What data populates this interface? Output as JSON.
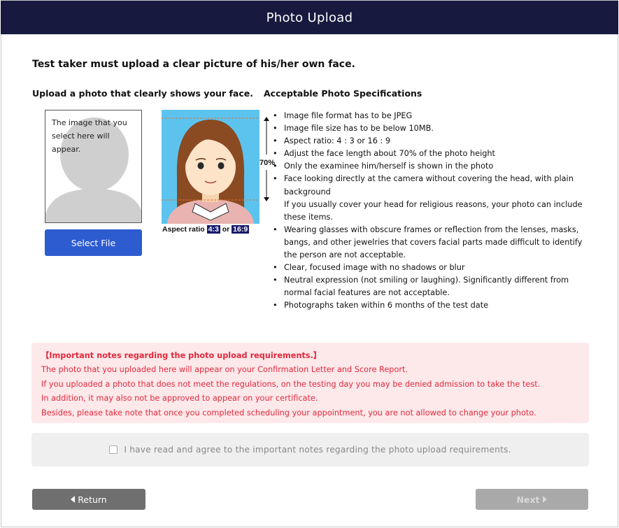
{
  "header": {
    "title": "Photo Upload"
  },
  "intro": "Test taker must upload a clear picture of his/her own face.",
  "upload": {
    "heading": "Upload a photo that clearly shows your face.",
    "preview_text": "The image that you select here will appear.",
    "select_button": "Select File"
  },
  "sample": {
    "aspect_label": "Aspect ratio",
    "ratio_a": "4:3",
    "or": "or",
    "ratio_b": "16:9",
    "face_percent": "70%"
  },
  "specs": {
    "heading": "Acceptable Photo Specifications",
    "items": [
      "Image file format has to be JPEG",
      "Image file size has to be below 10MB.",
      "Aspect ratio: 4 : 3 or 16 : 9",
      "Adjust the face length about 70% of the photo height",
      "Only the examinee him/herself is shown in the photo",
      "Face looking directly at the camera without covering the head, with plain background",
      "Wearing glasses with obscure frames or reflection from the lenses, masks, bangs, and other jewelries that covers facial parts made difficult to identify the person are not acceptable.",
      "Clear, focused image with no shadows or blur",
      "Neutral expression (not smiling or laughing). Significantly different from normal facial features are not acceptable.",
      "Photographs taken within 6 months of the test date"
    ],
    "religious_note": "If you usually cover your head for religious reasons, your photo can include these items."
  },
  "notice": {
    "title": "【Important notes regarding the photo upload requirements.】",
    "lines": [
      "The photo that you uploaded here will appear on your Confirmation Letter and Score Report.",
      "If you uploaded a photo that does not meet the regulations, on the testing day you may be denied admission to take the test.",
      "In addition, it may also not be approved to appear on your certificate.",
      "Besides, please take note that once you completed scheduling your appointment, you are not allowed to change your photo."
    ]
  },
  "agree": {
    "label": "I have read and agree to the important notes regarding the photo upload requirements.",
    "checked": false
  },
  "nav": {
    "return_label": "Return",
    "next_label": "Next"
  },
  "colors": {
    "header": "#171a3e",
    "primary": "#2d5bd0",
    "notice_bg": "#fde8ea",
    "notice_text": "#e02a3c"
  }
}
